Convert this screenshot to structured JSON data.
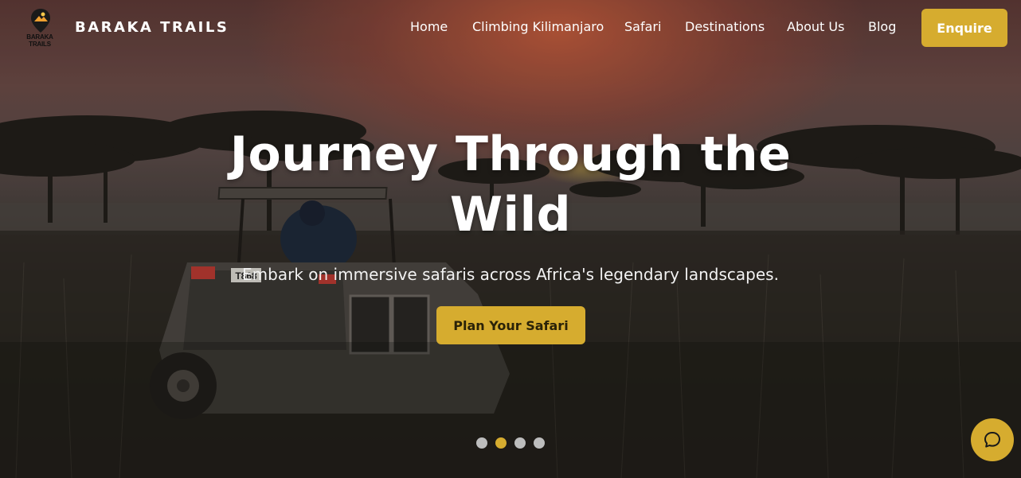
{
  "brand": {
    "logo_text": "BARAKA TRAILS",
    "name": "BARAKA TRAILS"
  },
  "nav": {
    "items": [
      {
        "label": "Home"
      },
      {
        "label": "Climbing Kilimanjaro"
      },
      {
        "label": "Safari"
      },
      {
        "label": "Destinations"
      },
      {
        "label": "About Us"
      },
      {
        "label": "Blog"
      }
    ],
    "enquire_label": "Enquire"
  },
  "hero": {
    "headline": "Journey Through the Wild",
    "subheadline": "Embark on immersive safaris across Africa's legendary landscapes.",
    "cta_label": "Plan Your Safari",
    "vehicle_plate": "T868"
  },
  "carousel": {
    "slide_count": 4,
    "active_index": 1
  },
  "chat": {
    "icon": "chat-bubble-icon"
  },
  "colors": {
    "accent": "#d6ac2f",
    "text": "#ffffff",
    "inactive_dot": "#bdbdbd"
  }
}
